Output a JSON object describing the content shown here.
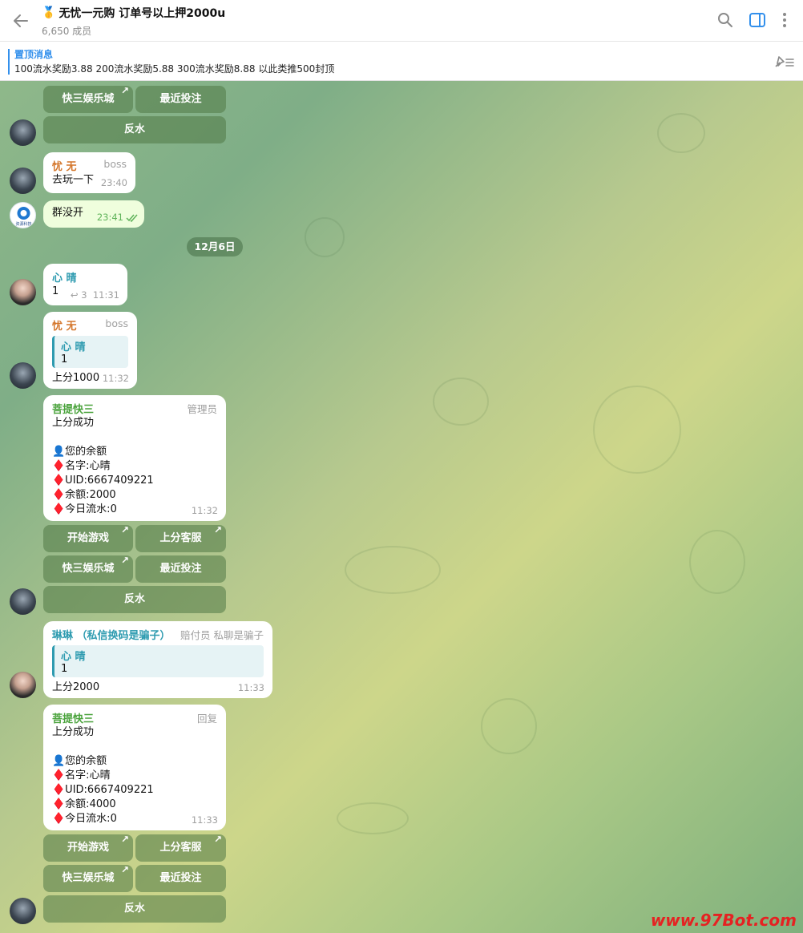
{
  "header": {
    "title_emoji": "🥇",
    "title": "无忧一元购 订单号以上押2000u",
    "members": "6,650 成员"
  },
  "pinned": {
    "title": "置顶消息",
    "text": "100流水奖励3.88 200流水奖励5.88 300流水奖励8.88 以此类推500封顶"
  },
  "keyboard_labels": {
    "start_game": "开始游戏",
    "topup_service": "上分客服",
    "casino": "快三娱乐城",
    "recent_bets": "最近投注",
    "rebate": "反水"
  },
  "messages": {
    "m1": {
      "name": "忧 无",
      "role": "boss",
      "text": "去玩一下",
      "time": "23:40"
    },
    "m2": {
      "text": "群没开",
      "time": "23:41"
    },
    "date": "12月6日",
    "m3": {
      "name": "心 晴",
      "text": "1",
      "replies": "3",
      "time": "11:31"
    },
    "m4": {
      "name": "忧 无",
      "role": "boss",
      "reply_name": "心 晴",
      "reply_text": "1",
      "text": "上分1000",
      "time": "11:32"
    },
    "m5": {
      "name": "菩提快三",
      "role": "管理员",
      "text": "上分成功\n\n👤您的余额\n♦️名字:心晴\n♦️UID:6667409221\n♦️余额:2000\n♦️今日流水:0",
      "time": "11:32"
    },
    "m6": {
      "name": "琳琳 （私信换码是骗子）",
      "role": "赔付员 私聊是骗子",
      "reply_name": "心 晴",
      "reply_text": "1",
      "text": "上分2000",
      "time": "11:33"
    },
    "m7": {
      "name": "菩提快三",
      "role": "回复",
      "text": "上分成功\n\n👤您的余额\n♦️名字:心晴\n♦️UID:6667409221\n♦️余额:4000\n♦️今日流水:0",
      "time": "11:33"
    }
  },
  "avatar_text": "资源科技",
  "watermark": "www.97Bot.com"
}
